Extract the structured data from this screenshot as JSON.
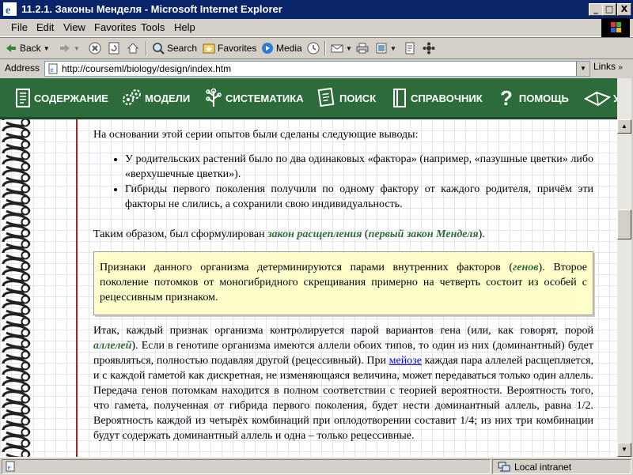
{
  "window": {
    "title": "11.2.1. Законы Менделя - Microsoft Internet Explorer",
    "minimize_glyph": "_",
    "maximize_glyph": "□",
    "close_glyph": "X"
  },
  "menu": [
    "File",
    "Edit",
    "View",
    "Favorites",
    "Tools",
    "Help"
  ],
  "toolbar": {
    "back_label": "Back",
    "search_label": "Search",
    "favorites_label": "Favorites",
    "media_label": "Media"
  },
  "address": {
    "label": "Address",
    "url": "http://courseml/biology/design/index.htm",
    "links_label": "Links"
  },
  "site_nav": {
    "items": [
      "СОДЕРЖАНИЕ",
      "МОДЕЛИ",
      "СИСТЕМАТИКА",
      "ПОИСК",
      "СПРАВОЧНИК",
      "ПОМОЩЬ",
      "У"
    ]
  },
  "content": {
    "intro": "На основании этой серии опытов были сделаны следующие выводы:",
    "bullets": [
      "У родительских растений было по два одинаковых «фактора» (например, «пазушные цветки» либо «верхушечные цветки»).",
      "Гибриды первого поколения получили по одному фактору от каждого родителя, причём эти факторы не слились, а сохранили свою индивидуальность."
    ],
    "law_pre": "Таким образом, был сформулирован ",
    "law_name": "закон расщепления",
    "law_mid": " (",
    "law_alt": "первый закон Менделя",
    "law_post": ").",
    "box_pre": "Признаки данного организма детерминируются парами внутренних факторов (",
    "box_term": "генов",
    "box_post": "). Второе поколение потомков от моногибридного скрещивания примерно на четверть состоит из особей с рецессивным признаком.",
    "p2_pre": "Итак, каждый признак организма контролируется парой вариантов гена (или, как говорят, порой ",
    "p2_term": "аллелей",
    "p2_mid": "). Если в генотипе организма имеются аллели обоих типов, то один из них (доминантный) будет проявляться, полностью подавляя другой (рецессивный). При ",
    "p2_link": "мейозе",
    "p2_post": " каждая пара аллелей расщепляется, и с каждой гаметой как дискретная, не изменяющаяся величина, может передаваться только один аллель. Передача генов потомкам находится в полном соответствии с теорией вероятности. Вероятность того, что гамета, полученная от гибрида первого поколения, будет нести доминантный аллель, равна 1/2. Вероятность каждой из четырёх комбинаций при оплодотворении составит 1/4; из них три комбинации будут содержать доминантный аллель и одна – только рецессивные."
  },
  "status": {
    "zone": "Local intranet"
  },
  "colors": {
    "titlebar": "#0a246a",
    "chrome": "#d4d0c8",
    "site_nav_green": "#2e6b3a",
    "note_box": "#ffffcc",
    "margin_line": "#9c2a2a"
  },
  "icons": {
    "toolbar": [
      "back-arrow-icon",
      "forward-arrow-icon",
      "stop-icon",
      "refresh-icon",
      "home-icon",
      "search-icon",
      "favorites-icon",
      "media-icon",
      "history-icon",
      "mail-icon",
      "print-icon",
      "edit-icon",
      "discuss-icon",
      "messenger-icon"
    ],
    "site_nav": [
      "book-icon",
      "gears-icon",
      "tree-icon",
      "notebook-icon",
      "reference-book-icon",
      "question-icon",
      "book-open-icon"
    ]
  }
}
